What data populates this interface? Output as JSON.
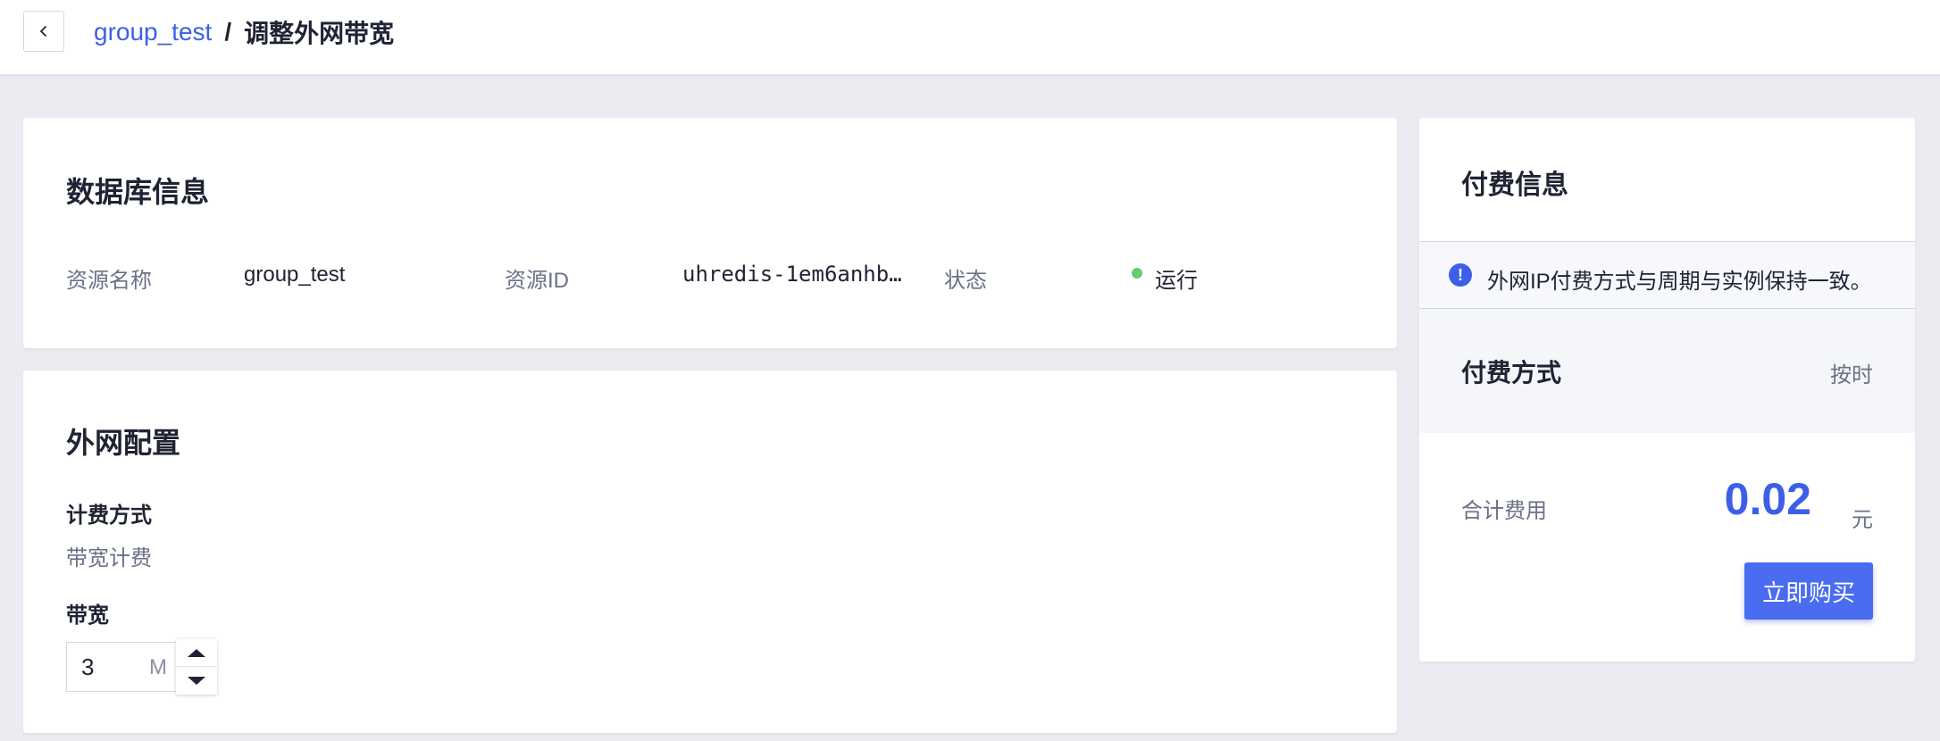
{
  "header": {
    "breadcrumb_link": "group_test",
    "separator": "/",
    "current_page": "调整外网带宽"
  },
  "db_info": {
    "title": "数据库信息",
    "resource_name_label": "资源名称",
    "resource_name_value": "group_test",
    "resource_id_label": "资源ID",
    "resource_id_value": "uhredis-1em6anhb…",
    "status_label": "状态",
    "status_value": "运行",
    "status_color": "#5fcf73"
  },
  "network_config": {
    "title": "外网配置",
    "billing_label": "计费方式",
    "billing_value": "带宽计费",
    "bandwidth_label": "带宽",
    "bandwidth_value": "3",
    "bandwidth_unit": "M"
  },
  "payment": {
    "title": "付费信息",
    "notice": "外网IP付费方式与周期与实例保持一致。",
    "pay_mode_label": "付费方式",
    "pay_mode_value": "按时",
    "total_label": "合计费用",
    "total_amount": "0.02",
    "total_unit": "元",
    "buy_button": "立即购买",
    "accent_color": "#3d5fe8"
  }
}
